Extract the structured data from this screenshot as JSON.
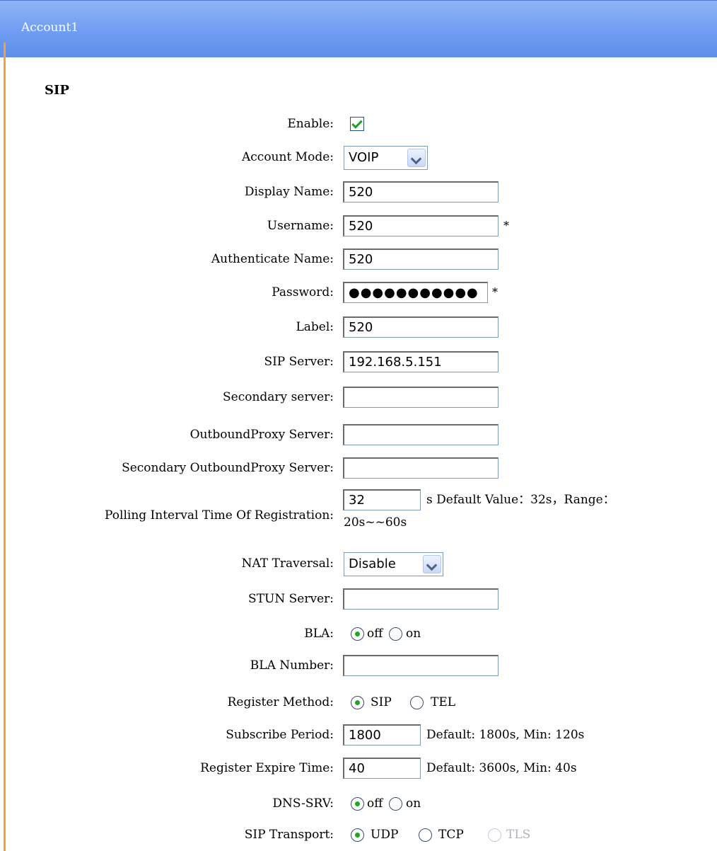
{
  "header": {
    "title": "Account1"
  },
  "section_title": "SIP",
  "fields": {
    "enable": {
      "label": "Enable:",
      "checked": true
    },
    "account_mode": {
      "label": "Account Mode:",
      "value": "VOIP"
    },
    "display_name": {
      "label": "Display Name:",
      "value": "520"
    },
    "username": {
      "label": "Username:",
      "value": "520",
      "required": "*"
    },
    "authenticate_name": {
      "label": "Authenticate Name:",
      "value": "520"
    },
    "password": {
      "label": "Password:",
      "value": "●●●●●●●●●●●",
      "required": "*"
    },
    "label": {
      "label": "Label:",
      "value": "520"
    },
    "sip_server": {
      "label": "SIP Server:",
      "value": "192.168.5.151"
    },
    "secondary_server": {
      "label": "Secondary server:",
      "value": ""
    },
    "outbound_proxy": {
      "label": "OutboundProxy Server:",
      "value": ""
    },
    "secondary_outbound_proxy": {
      "label": "Secondary OutboundProxy Server:",
      "value": ""
    },
    "polling_interval": {
      "label": "Polling Interval Time Of Registration:",
      "value": "32",
      "hint_line1": "s Default Value：32s，Range：",
      "hint_line2": "20s~~60s"
    },
    "nat_traversal": {
      "label": "NAT Traversal:",
      "value": "Disable"
    },
    "stun_server": {
      "label": "STUN Server:",
      "value": ""
    },
    "bla": {
      "label": "BLA:",
      "options": [
        "off",
        "on"
      ],
      "selected": "off"
    },
    "bla_number": {
      "label": "BLA Number:",
      "value": ""
    },
    "register_method": {
      "label": "Register Method:",
      "options": [
        "SIP",
        "TEL"
      ],
      "selected": "SIP"
    },
    "subscribe_period": {
      "label": "Subscribe Period:",
      "value": "1800",
      "hint": "Default: 1800s, Min: 120s"
    },
    "register_expire": {
      "label": "Register Expire Time:",
      "value": "40",
      "hint": "Default: 3600s, Min: 40s"
    },
    "dns_srv": {
      "label": "DNS-SRV:",
      "options": [
        "off",
        "on"
      ],
      "selected": "off"
    },
    "sip_transport": {
      "label": "SIP Transport:",
      "options": [
        "UDP",
        "TCP",
        "TLS"
      ],
      "selected": "UDP",
      "disabled": [
        "TLS"
      ]
    }
  }
}
